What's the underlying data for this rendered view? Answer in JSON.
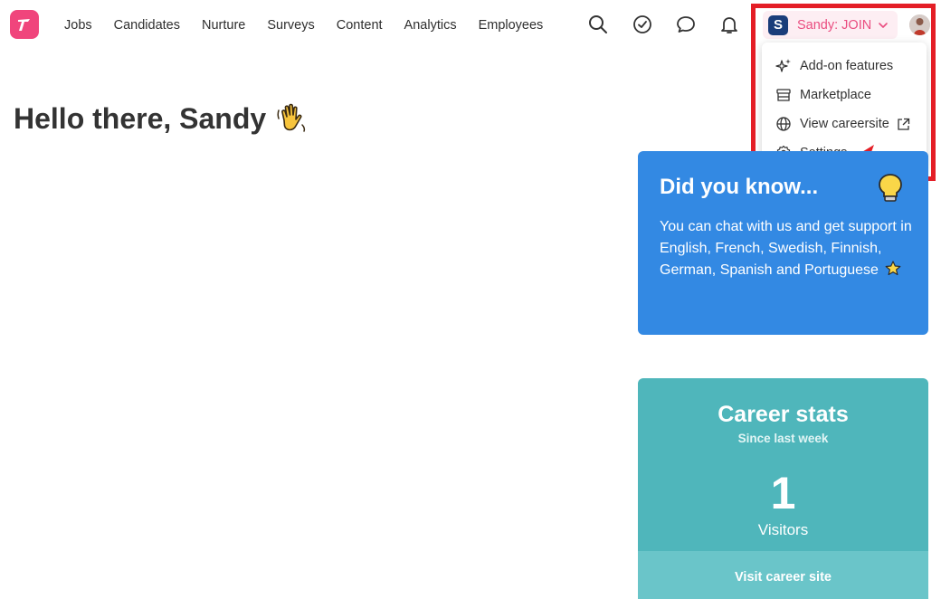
{
  "nav": {
    "items": [
      {
        "label": "Jobs"
      },
      {
        "label": "Candidates"
      },
      {
        "label": "Nurture"
      },
      {
        "label": "Surveys"
      },
      {
        "label": "Content"
      },
      {
        "label": "Analytics"
      },
      {
        "label": "Employees"
      }
    ]
  },
  "header": {
    "account_initial": "S",
    "account_label": "Sandy: JOIN"
  },
  "dropdown": {
    "items": [
      {
        "label": "Add-on features",
        "icon": "sparkles-icon"
      },
      {
        "label": "Marketplace",
        "icon": "store-icon"
      },
      {
        "label": "View careersite",
        "icon": "globe-icon"
      },
      {
        "label": "Settings",
        "icon": "gear-icon"
      }
    ]
  },
  "main": {
    "greeting": "Hello there, Sandy"
  },
  "did_you_know": {
    "title": "Did you know...",
    "body": "You can chat with us and get support in English, French, Swedish, Finnish, German, Spanish and Portuguese"
  },
  "career_stats": {
    "title": "Career stats",
    "subtitle": "Since last week",
    "value": "1",
    "value_label": "Visitors",
    "link_label": "Visit career site"
  },
  "colors": {
    "brand": "#f0457c",
    "account_text": "#ea4d80",
    "info_card": "#3389e3",
    "stats_card": "#4fb6bb",
    "annotation": "#e41e26"
  }
}
